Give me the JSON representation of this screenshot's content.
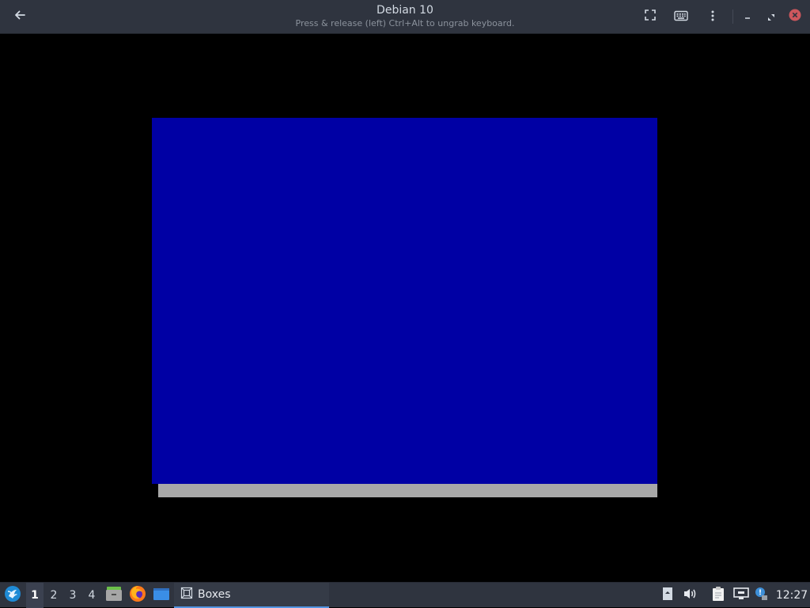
{
  "window": {
    "title": "Debian 10",
    "subtitle": "Press & release (left) Ctrl+Alt to ungrab keyboard.",
    "icons": {
      "back": "back-arrow-icon",
      "fullscreen": "fullscreen-icon",
      "keyboard": "keyboard-icon",
      "menu": "menu-icon",
      "minimize": "minimize-icon",
      "maximize": "maximize-icon",
      "close": "close-icon"
    }
  },
  "vm": {
    "screen_color": "#0000a4",
    "shadow_color": "#a8a8a8"
  },
  "taskbar": {
    "workspaces": [
      "1",
      "2",
      "3",
      "4"
    ],
    "active_workspace": "1",
    "launchers": [
      "files-icon",
      "firefox-icon",
      "show-desktop-icon"
    ],
    "tasks": [
      {
        "label": "Boxes",
        "icon": "boxes-icon",
        "active": true
      }
    ],
    "tray": [
      "tray-arrow-icon",
      "volume-icon",
      "clipboard-icon",
      "network-icon",
      "update-notifier-icon"
    ],
    "clock": "12:27"
  },
  "colors": {
    "panel_bg": "#2f343f",
    "accent": "#5294e2",
    "close_red": "#cc575d"
  }
}
